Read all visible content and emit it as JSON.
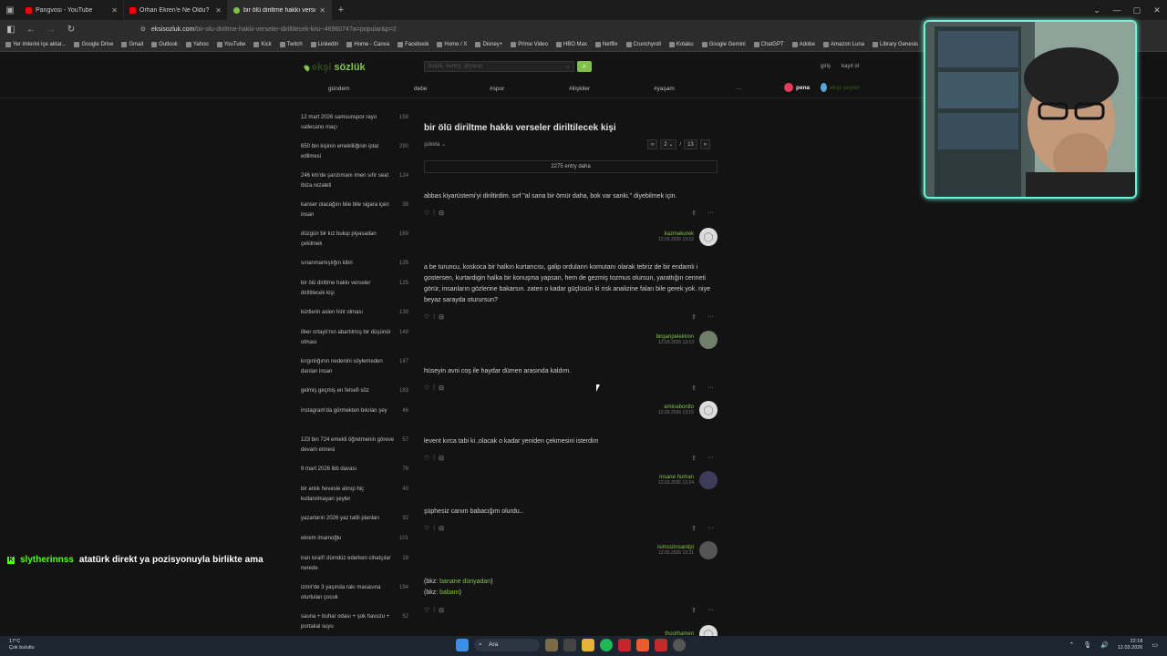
{
  "browser": {
    "tabs": [
      {
        "title": "Pangvosi - YouTube",
        "color": "#ff0000"
      },
      {
        "title": "Orhan Ekren'e Ne Oldu? İngilte",
        "color": "#ff0000"
      },
      {
        "title": "bir ölü diriltme hakkı verseler di",
        "color": "#81c14b",
        "active": true
      }
    ],
    "new_tab": "+",
    "url_host": "eksisozluk.com",
    "url_path": "/bir-olu-diriltme-hakki-verseler-diriltilecek-kisi--4696074?a=popular&p=2",
    "bookmarks": [
      "Yer imlerini içe aktar...",
      "Google Drive",
      "Gmail",
      "Outlook",
      "Yahoo",
      "YouTube",
      "Kick",
      "Twitch",
      "LinkedIn",
      "Home - Canva",
      "Facebook",
      "Home / X",
      "Disney+",
      "Prime Video",
      "HBO Max",
      "Netflix",
      "Crunchyroll",
      "Kotaku",
      "Google Gemini",
      "ChatGPT",
      "Adobe",
      "Amazon Luna",
      "Library Genesis",
      "Internet"
    ]
  },
  "site": {
    "logo_prefix": "ekşi",
    "logo": "sözlük",
    "search_placeholder": "başlık, #entry, @yazar",
    "login": "giriş",
    "register": "kayıt ol",
    "nav": [
      "gündem",
      "debe",
      "#spor",
      "#ilişkiler",
      "#yaşam",
      "···"
    ],
    "pena": "pena",
    "ekssz": "ekşi şeyler"
  },
  "sidebar": [
    {
      "t": "12 mart 2026 samsunspor rayo vallecano maçı",
      "n": "158"
    },
    {
      "t": "650 bin kişinin emekliliğinin iptal edilmesi",
      "n": "290"
    },
    {
      "t": "246 km'de şanzımanı imen sıfır seat ibiza rezaleti",
      "n": "124"
    },
    {
      "t": "kanser olacağını bile bile sigara içen insan",
      "n": "38"
    },
    {
      "t": "düzgün bir kız bulup piyasadan çekilmek",
      "n": "169"
    },
    {
      "t": "sınanmamışlığın kibri",
      "n": "135"
    },
    {
      "t": "bir ölü diriltme hakkı verseler diriltilecek kişi",
      "n": "125"
    },
    {
      "t": "kürtlerin aslen hint olması",
      "n": "139"
    },
    {
      "t": "ilber ortaylı'nın abartılmış bir düşünür olması",
      "n": "149"
    },
    {
      "t": "kırgınlığının nedenini söylemeden darılan insan",
      "n": "147"
    },
    {
      "t": "gelmiş geçmiş en felsefi söz",
      "n": "183"
    },
    {
      "t": "instagram'da görmekten bıkılan şey",
      "n": "46"
    },
    {
      "t": "123 bin 724 emekli öğretmenin göreve devam etmesi",
      "n": "57"
    },
    {
      "t": "9 mart 2026 ibb davası",
      "n": "76"
    },
    {
      "t": "bir anlık hevesle alınıp hiç kullanılmayan şeyler",
      "n": "40"
    },
    {
      "t": "yazarların 2026 yaz tatili planları",
      "n": "92"
    },
    {
      "t": "ekrem imamoğlu",
      "n": "101"
    },
    {
      "t": "iran israil'i dümdüz ederken cihatçılar nerede",
      "n": "18"
    },
    {
      "t": "izmir'de 3 yaşında rakı masasına oturtulan çocuk",
      "n": "194"
    },
    {
      "t": "sauna + buhar odası + şok havuzu + portakal suyu",
      "n": "52"
    }
  ],
  "topic": {
    "title": "bir ölü diriltme hakkı verseler diriltilecek kişi",
    "sukela": "şükela ⌄",
    "page": "2",
    "total_pages": "13",
    "prev": "«",
    "next": "»",
    "sep": "/",
    "more": "2275 entry daha"
  },
  "entries": [
    {
      "text": "abbas kiyarüstemi'yi diriltirdim. sırf \"al sana bir ömür daha, bok var sanki.\" diyebilmek için.",
      "author": "kazmakurek",
      "date": "12.03.2026 13:12"
    },
    {
      "text": "a be turuncu, koskoca bir halkın kurtarıcısı, galip orduların komutanı olarak tebriz de bir endamlı i gostersen, kurtardigin halka bir konuşma yapsan, hem de gezmiş tozmus olursun, yarattığın cenneti görür, insanların gözlerine bakarsın. zaten o kadar güçlüsün ki risk analizine falan bile gerek yok. niye beyaz sarayda oturursun?",
      "author": "birgaripelektron",
      "date": "12.03.2026 13:13"
    },
    {
      "text": "hüseyin avni coş ile haydar dümen arasında kaldım.",
      "author": "aminabonito",
      "date": "12.03.2026 13:15"
    },
    {
      "text": "levent kırca tabi ki ,olacak o kadar yeniden çekmesini isterdim",
      "author": "insane human",
      "date": "12.03.2026 13:24"
    },
    {
      "text": "şüphesiz canım babacığım olurdu..",
      "author": "isimsizinsantipi",
      "date": "12.03.2026 13:31"
    },
    {
      "bkz1_prefix": "(bkz: ",
      "bkz1": "banane dünyadan",
      "bkz2_prefix": "(bkz: ",
      "bkz2": "babam",
      "bkz_suffix": ")",
      "author": "thoothamen"
    }
  ],
  "chat": {
    "user": "slytherinnss",
    "message": "atatürk direkt ya pozisyonuyla birlikte ama"
  },
  "taskbar": {
    "temp": "17°C",
    "weather": "Çok bulutlu",
    "search": "Ara",
    "time": "22:18",
    "date": "12.03.2026"
  }
}
